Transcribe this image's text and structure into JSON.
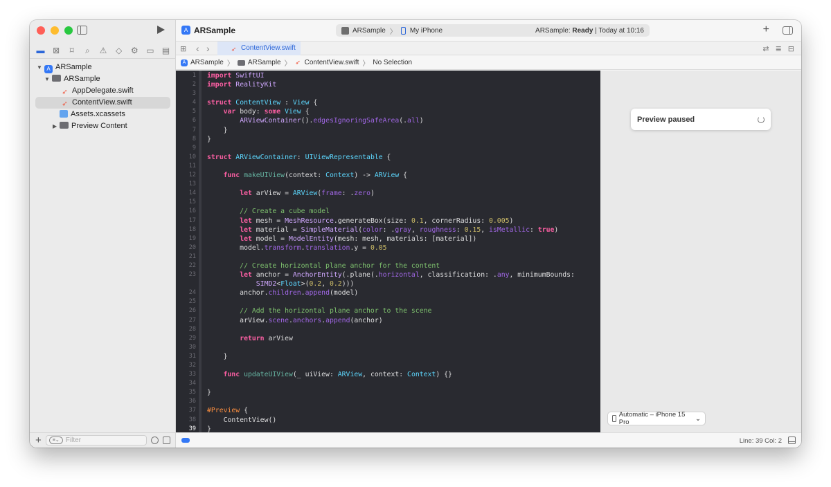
{
  "toolbar": {
    "app_title": "ARSample",
    "scheme": "ARSample",
    "destination": "My iPhone",
    "status_project": "ARSample:",
    "status_state": "Ready",
    "status_time": "| Today at 10:16"
  },
  "navigator": {
    "items": [
      {
        "label": "ARSample"
      },
      {
        "label": "ARSample"
      },
      {
        "label": "AppDelegate.swift"
      },
      {
        "label": "ContentView.swift"
      },
      {
        "label": "Assets.xcassets"
      },
      {
        "label": "Preview Content"
      }
    ],
    "filter_placeholder": "Filter"
  },
  "tab": {
    "label": "ContentView.swift"
  },
  "jumpbar": {
    "crumbs": [
      "ARSample",
      "ARSample",
      "ContentView.swift",
      "No Selection"
    ]
  },
  "editor": {
    "current_line": 39,
    "lines": [
      "import SwiftUI",
      "import RealityKit",
      "",
      "struct ContentView : View {",
      "    var body: some View {",
      "        ARViewContainer().edgesIgnoringSafeArea(.all)",
      "    }",
      "}",
      "",
      "struct ARViewContainer: UIViewRepresentable {",
      "",
      "    func makeUIView(context: Context) -> ARView {",
      "",
      "        let arView = ARView(frame: .zero)",
      "",
      "        // Create a cube model",
      "        let mesh = MeshResource.generateBox(size: 0.1, cornerRadius: 0.005)",
      "        let material = SimpleMaterial(color: .gray, roughness: 0.15, isMetallic: true)",
      "        let model = ModelEntity(mesh: mesh, materials: [material])",
      "        model.transform.translation.y = 0.05",
      "",
      "        // Create horizontal plane anchor for the content",
      "        let anchor = AnchorEntity(.plane(.horizontal, classification: .any, minimumBounds:",
      "            SIMD2<Float>(0.2, 0.2)))",
      "        anchor.children.append(model)",
      "",
      "        // Add the horizontal plane anchor to the scene",
      "        arView.scene.anchors.append(anchor)",
      "",
      "        return arView",
      "",
      "    }",
      "",
      "    func updateUIView(_ uiView: ARView, context: Context) {}",
      "",
      "}",
      "",
      "#Preview {",
      "    ContentView()",
      "}"
    ],
    "line_numbers": [
      "1",
      "2",
      "3",
      "4",
      "5",
      "6",
      "7",
      "8",
      "9",
      "10",
      "11",
      "12",
      "13",
      "14",
      "15",
      "16",
      "17",
      "18",
      "19",
      "20",
      "21",
      "22",
      "23",
      "",
      "24",
      "25",
      "26",
      "27",
      "28",
      "29",
      "30",
      "31",
      "32",
      "33",
      "34",
      "35",
      "36",
      "37",
      "38",
      "39"
    ]
  },
  "preview": {
    "status": "Preview paused",
    "device": "Automatic – iPhone 15 Pro"
  },
  "statusbar": {
    "cursor": "Line: 39  Col: 2"
  }
}
